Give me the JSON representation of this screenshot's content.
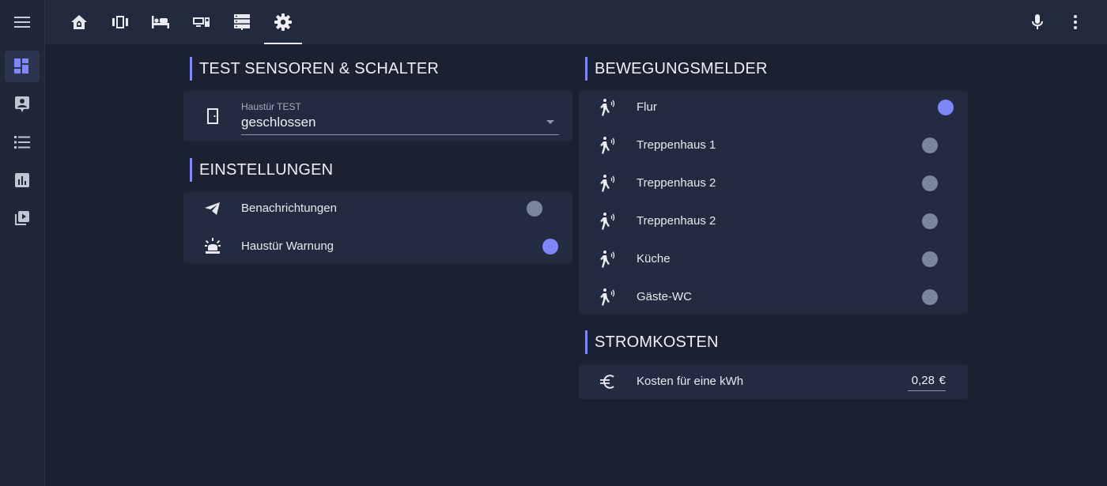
{
  "colors": {
    "background": "#1b2130",
    "card": "#222b3f",
    "accent": "#7f86f7",
    "toggle_off": "#7a8599"
  },
  "sidebar": {
    "menu_icon": "hamburger-icon",
    "items": [
      {
        "icon": "dashboard-icon",
        "active": true
      },
      {
        "icon": "account-box-icon",
        "active": false
      },
      {
        "icon": "list-icon",
        "active": false
      },
      {
        "icon": "chart-box-icon",
        "active": false
      },
      {
        "icon": "media-library-icon",
        "active": false
      }
    ]
  },
  "topbar": {
    "tabs": [
      {
        "icon": "home-icon",
        "active": false
      },
      {
        "icon": "carousel-icon",
        "active": false
      },
      {
        "icon": "bed-icon",
        "active": false
      },
      {
        "icon": "devices-icon",
        "active": false
      },
      {
        "icon": "server-icon",
        "active": false
      },
      {
        "icon": "gear-icon",
        "active": true
      }
    ],
    "right": [
      "microphone-icon",
      "more-vertical-icon"
    ]
  },
  "sections": {
    "test": {
      "title": "TEST SENSOREN & SCHALTER",
      "select": {
        "label": "Haustür TEST",
        "value": "geschlossen",
        "icon": "door-icon"
      }
    },
    "settings": {
      "title": "EINSTELLUNGEN",
      "rows": [
        {
          "label": "Benachrichtungen",
          "icon": "telegram-send-icon",
          "state": "off"
        },
        {
          "label": "Haustür Warnung",
          "icon": "alarm-light-icon",
          "state": "on"
        }
      ]
    },
    "motion": {
      "title": "BEWEGUNGSMELDER",
      "rows": [
        {
          "label": "Flur",
          "icon": "motion-sensor-icon",
          "state": "on"
        },
        {
          "label": "Treppenhaus 1",
          "icon": "motion-sensor-icon",
          "state": "off"
        },
        {
          "label": "Treppenhaus 2",
          "icon": "motion-sensor-icon",
          "state": "off"
        },
        {
          "label": "Treppenhaus 2",
          "icon": "motion-sensor-icon",
          "state": "off"
        },
        {
          "label": "Küche",
          "icon": "motion-sensor-icon",
          "state": "off"
        },
        {
          "label": "Gäste-WC",
          "icon": "motion-sensor-icon",
          "state": "off"
        }
      ]
    },
    "power": {
      "title": "STROMKOSTEN",
      "row": {
        "label": "Kosten für eine kWh",
        "icon": "euro-icon",
        "value": "0,28",
        "unit": "€"
      }
    }
  }
}
